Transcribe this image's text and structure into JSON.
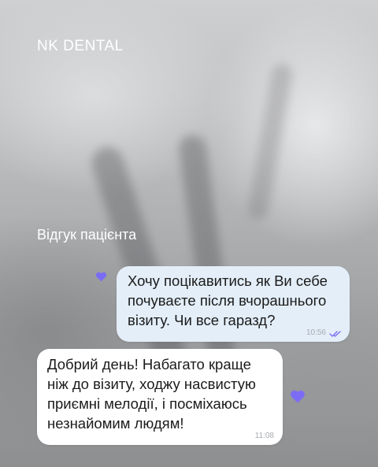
{
  "header": {
    "brand": "NK DENTAL"
  },
  "caption": {
    "text": "Відгук пацієнта"
  },
  "chat": {
    "messages": [
      {
        "direction": "outgoing",
        "text": "Хочу поцікавитись як Ви себе\nпочуваєте після вчорашнього\nвізиту. Чи все гаразд?",
        "time": "10:56",
        "status": "read"
      },
      {
        "direction": "incoming",
        "text": "Добрий день! Набагато краще\nніж до візиту, ходжу насвистую\nприємні мелодії, і посміхаюсь\nнезнайомим людям!",
        "time": "11:08"
      }
    ],
    "reaction_icon": "heart-icon",
    "accent_color": "#7b6cf6",
    "outgoing_bubble_color": "#e3eef8",
    "incoming_bubble_color": "#ffffff"
  }
}
